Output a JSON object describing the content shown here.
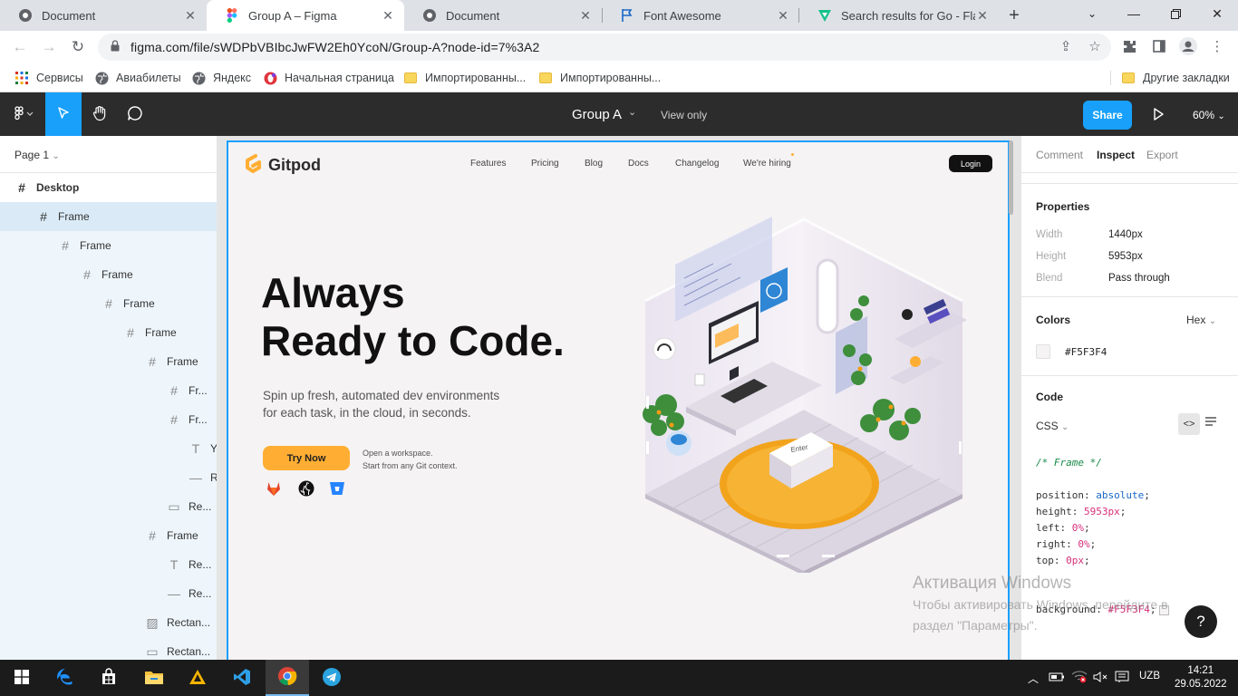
{
  "browser": {
    "tabs": [
      {
        "title": "Document",
        "icon": "chrome-logo-icon"
      },
      {
        "title": "Group A – Figma",
        "icon": "figma-logo-icon",
        "active": true
      },
      {
        "title": "Document",
        "icon": "chrome-logo-icon"
      },
      {
        "title": "Font Awesome",
        "icon": "flag-icon"
      },
      {
        "title": "Search results for Go - Flatic",
        "icon": "flaticon-icon"
      }
    ],
    "address": "figma.com/file/sWDPbVBIbcJwFW2Eh0YcoN/Group-A?node-id=7%3A2",
    "bookmarks": [
      {
        "label": "Сервисы",
        "icon": "apps-grid-icon"
      },
      {
        "label": "Авиабилеты",
        "icon": "globe-icon"
      },
      {
        "label": "Яндекс",
        "icon": "globe-icon"
      },
      {
        "label": "Начальная страница",
        "icon": "opera-icon"
      },
      {
        "label": "Импортированны...",
        "icon": "folder-icon"
      },
      {
        "label": "Импортированны...",
        "icon": "folder-icon"
      }
    ],
    "other_bookmarks": "Другие закладки"
  },
  "figma": {
    "title": "Group A",
    "view_mode": "View only",
    "share": "Share",
    "zoom": "60%",
    "page": "Page 1",
    "layers": [
      {
        "label": "Desktop",
        "icon": "frame-icon"
      },
      {
        "label": "Frame",
        "icon": "frame-icon"
      },
      {
        "label": "Frame",
        "icon": "frame-icon"
      },
      {
        "label": "Frame",
        "icon": "frame-icon"
      },
      {
        "label": "Frame",
        "icon": "frame-icon"
      },
      {
        "label": "Frame",
        "icon": "frame-icon"
      },
      {
        "label": "Frame",
        "icon": "frame-icon"
      },
      {
        "label": "Fr...",
        "icon": "frame-icon"
      },
      {
        "label": "Fr...",
        "icon": "frame-icon"
      },
      {
        "label": "Y",
        "icon": "text-icon"
      },
      {
        "label": "R",
        "icon": "line-icon"
      },
      {
        "label": "Re...",
        "icon": "rectangle-icon"
      },
      {
        "label": "Frame",
        "icon": "frame-icon"
      },
      {
        "label": "Re...",
        "icon": "text-icon"
      },
      {
        "label": "Re...",
        "icon": "line-icon"
      },
      {
        "label": "Rectan...",
        "icon": "image-icon"
      },
      {
        "label": "Rectan...",
        "icon": "rectangle-icon"
      }
    ],
    "inspect": {
      "tabs": [
        "Comment",
        "Inspect",
        "Export"
      ],
      "properties_title": "Properties",
      "properties": [
        {
          "label": "Width",
          "value": "1440px"
        },
        {
          "label": "Height",
          "value": "5953px"
        },
        {
          "label": "Blend",
          "value": "Pass through"
        }
      ],
      "colors_title": "Colors",
      "color_format": "Hex",
      "color_value": "#F5F3F4",
      "code_title": "Code",
      "code_lang": "CSS",
      "code_comment": "/* Frame */",
      "code_lines": [
        {
          "prop": "position:",
          "value": "absolute",
          "kind": "blue"
        },
        {
          "prop": "height:",
          "value": "5953px",
          "kind": "pink"
        },
        {
          "prop": "left:",
          "value": "0%",
          "kind": "pink"
        },
        {
          "prop": "right:",
          "value": "0%",
          "kind": "pink"
        },
        {
          "prop": "top:",
          "value": "0px",
          "kind": "pink"
        }
      ],
      "code_bg_prop": "background:",
      "code_bg_value": "#F5F3F4",
      "help": "?"
    }
  },
  "gitpod": {
    "brand": "Gitpod",
    "nav": [
      "Features",
      "Pricing",
      "Blog",
      "Docs",
      "Changelog",
      "We're hiring"
    ],
    "login": "Login",
    "headline_1": "Always",
    "headline_2": "Ready to Code.",
    "subline_1": "Spin up fresh, automated dev environments",
    "subline_2": "for each task, in the cloud, in seconds.",
    "cta": "Try Now",
    "note_1": "Open a workspace.",
    "note_2": "Start from any Git context.",
    "providers": [
      "gitlab-icon",
      "github-icon",
      "bitbucket-icon"
    ],
    "illustration_key": "Enter"
  },
  "windows": {
    "activation_title": "Активация Windows",
    "activation_line_1": "Чтобы активировать Windows, перейдите в",
    "activation_line_2": "раздел \"Параметры\".",
    "lang": "UZB",
    "time": "14:21",
    "date": "29.05.2022"
  },
  "colors": {
    "figma_blue": "#18A0FB",
    "gitpod_orange": "#FFAE33",
    "frame_bg": "#F5F3F4"
  }
}
